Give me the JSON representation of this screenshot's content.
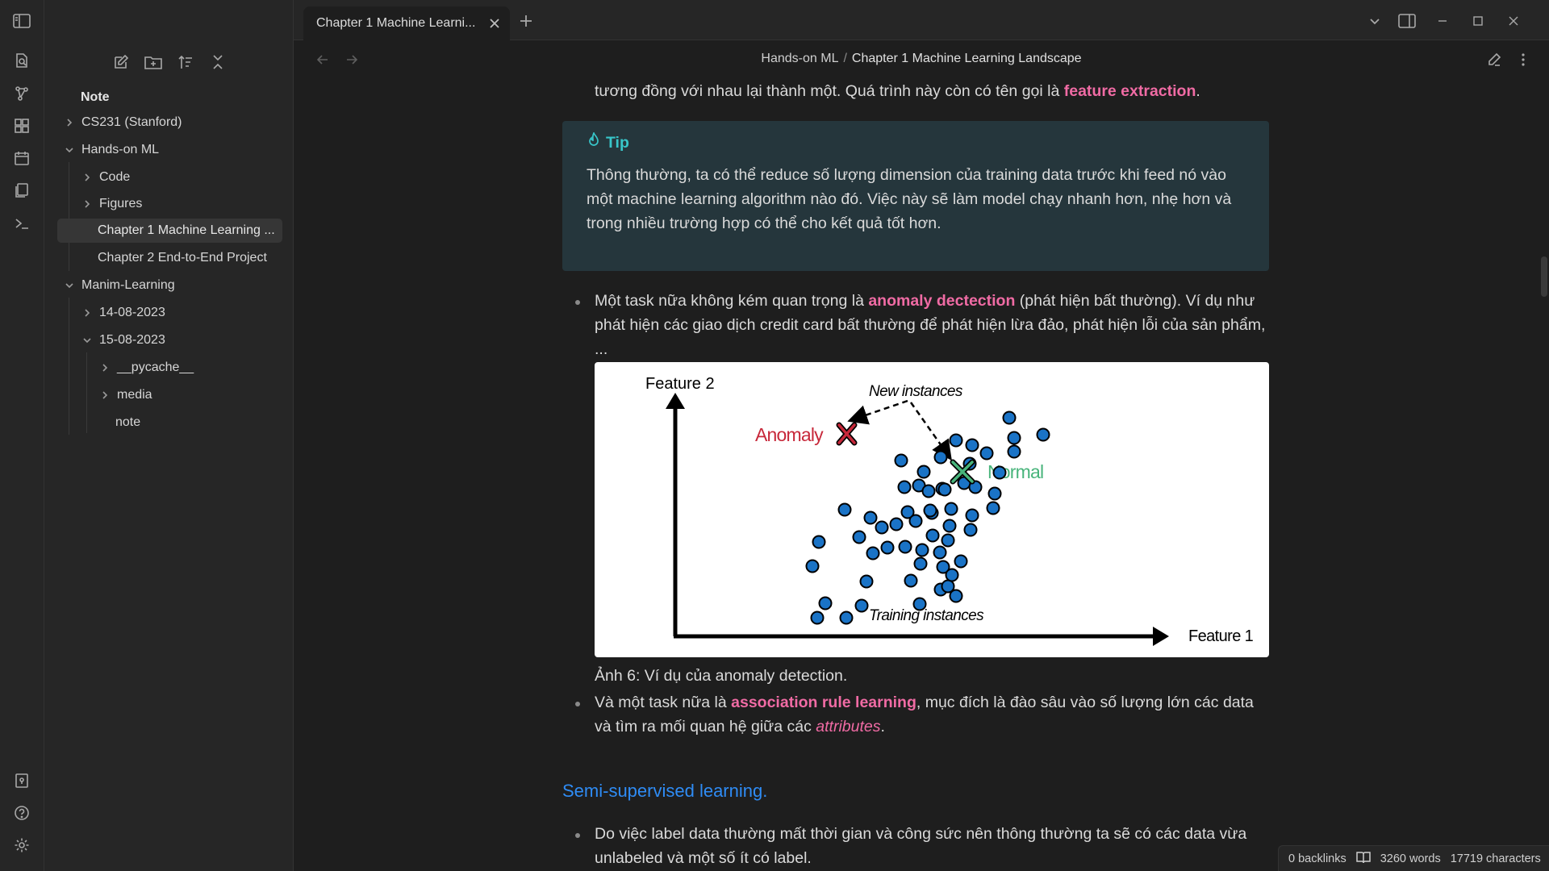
{
  "window": {
    "tab_title": "Chapter 1 Machine Learni..."
  },
  "breadcrumb": {
    "parent": "Hands-on ML",
    "separator": "/",
    "current": "Chapter 1 Machine Learning Landscape"
  },
  "sidebar": {
    "root": "Note",
    "items": [
      {
        "label": "CS231 (Stanford)"
      },
      {
        "label": "Hands-on ML"
      },
      {
        "label": "Code"
      },
      {
        "label": "Figures"
      },
      {
        "label": "Chapter 1 Machine Learning ..."
      },
      {
        "label": "Chapter 2 End-to-End Project"
      },
      {
        "label": "Manim-Learning"
      },
      {
        "label": "14-08-2023"
      },
      {
        "label": "15-08-2023"
      },
      {
        "label": "__pycache__"
      },
      {
        "label": "media"
      },
      {
        "label": "note"
      }
    ]
  },
  "content": {
    "intro_line": {
      "text": "tương đồng với nhau lại thành một. Quá trình này còn có tên gọi là ",
      "highlight": "feature extraction",
      "tail": "."
    },
    "callout": {
      "title": "Tip",
      "body": "Thông thường, ta có thể reduce số lượng dimension của training data trước khi feed nó vào một machine learning algorithm nào đó. Việc này sẽ làm model chạy nhanh hơn, nhẹ hơn và trong nhiều trường hợp có thể cho kết quả tốt hơn."
    },
    "bullet1": {
      "pre": "Một task nữa không kém quan trọng là ",
      "highlight": "anomaly dectection",
      "post": " (phát hiện bất thường). Ví dụ như phát hiện các giao dịch credit card bất thường để phát hiện lừa đảo, phát hiện lỗi của sản phẩm, ..."
    },
    "figure": {
      "feature2": "Feature 2",
      "feature1": "Feature 1",
      "new_instances": "New instances",
      "anomaly": "Anomaly",
      "normal": "Normal",
      "training": "Training instances"
    },
    "caption": "Ảnh 6: Ví dụ của anomaly detection.",
    "bullet2": {
      "pre": "Và một task nữa là ",
      "highlight": "association rule learning",
      "mid": ", mục đích là đào sâu vào số lượng lớn các data và tìm ra mối quan hệ giữa các ",
      "italic": "attributes",
      "post": "."
    },
    "heading": "Semi-supervised learning.",
    "bullet3": "Do việc label data thường mất thời gian và công sức nên thông thường ta sẽ có các data vừa unlabeled và một số ít có label."
  },
  "status": {
    "backlinks": "0 backlinks",
    "words": "3260 words",
    "characters": "17719 characters"
  },
  "colors": {
    "accent_pink": "#f06ba4",
    "callout_title": "#38c5c9",
    "heading_blue": "#2f8cf5",
    "normal_green": "#48b47b",
    "anomaly_red": "#c7283a",
    "dot_blue": "#1a73c6"
  }
}
